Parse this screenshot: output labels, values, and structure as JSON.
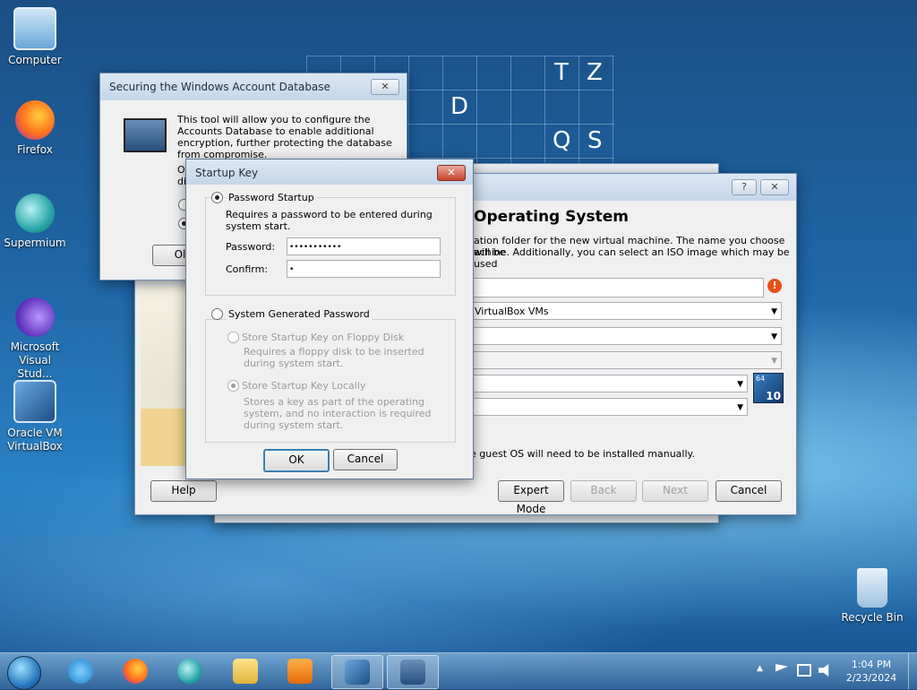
{
  "desktop": {
    "icons": [
      {
        "label": "Computer"
      },
      {
        "label": "Firefox"
      },
      {
        "label": "Supermium"
      },
      {
        "label": "Microsoft Visual Stud..."
      },
      {
        "label": "Oracle VM VirtualBox"
      },
      {
        "label": "Recycle Bin"
      }
    ],
    "wallpaper_letters": [
      "T",
      "Z",
      "D",
      "Q",
      "S"
    ]
  },
  "syskey_window": {
    "title": "Securing the Windows Account Database",
    "description": "This tool will allow you to configure the Accounts Database to enable additional encryption, further protecting the database from compromise.",
    "partial_text_1": "Or",
    "partial_text_2": "dis",
    "ok_partial": "Ol",
    "close_glyph": "✕"
  },
  "startup_key_dialog": {
    "title": "Startup Key",
    "close_glyph": "✕",
    "password_startup_label": "Password Startup",
    "password_startup_desc": "Requires a password to be entered during system start.",
    "password_label": "Password:",
    "password_value": "•••••••••••",
    "confirm_label": "Confirm:",
    "confirm_value": "•",
    "system_generated_label": "System Generated Password",
    "floppy_label": "Store Startup Key on Floppy Disk",
    "floppy_desc": "Requires a floppy disk to be inserted during system start.",
    "locally_label": "Store Startup Key Locally",
    "locally_desc": "Stores a key as part of the operating system, and no interaction is required during system start.",
    "ok_label": "OK",
    "cancel_label": "Cancel"
  },
  "vbox_wizard": {
    "heading": "Operating System",
    "desc_line1": "ation folder for the new virtual machine. The name you choose will be",
    "desc_line2": "achine. Additionally, you can select an ISO image which may be used",
    "folder_value": "VirtualBox VMs",
    "note": "e guest OS will need to be installed manually.",
    "help_label": "Help",
    "expert_label": "Expert Mode",
    "back_label": "Back",
    "next_label": "Next",
    "cancel_label": "Cancel",
    "help_glyph": "?",
    "close_glyph": "✕",
    "os_badge_top": "64",
    "os_badge_bottom": "10"
  },
  "taskbar": {
    "time": "1:04 PM",
    "date": "2/23/2024",
    "tray_chevron": "▲"
  }
}
